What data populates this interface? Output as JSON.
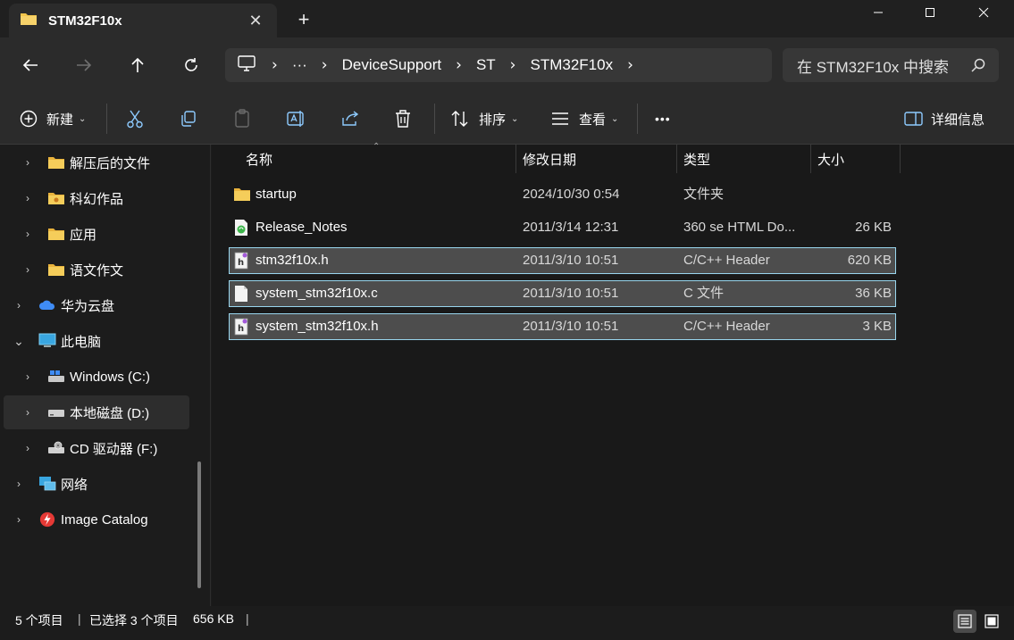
{
  "tab": {
    "title": "STM32F10x",
    "close_glyph": "✕",
    "new_tab_glyph": "+"
  },
  "window_buttons": {
    "minimize": "—",
    "maximize": "☐",
    "close": "✕"
  },
  "address": {
    "overflow": "···",
    "crumbs": [
      "DeviceSupport",
      "ST",
      "STM32F10x"
    ],
    "separator": "›"
  },
  "search": {
    "placeholder": "在 STM32F10x 中搜索"
  },
  "toolbar": {
    "new_label": "新建",
    "sort_label": "排序",
    "view_label": "查看",
    "more_label": "•••",
    "details_label": "详细信息"
  },
  "sidebar": {
    "items": [
      {
        "label": "解压后的文件",
        "icon": "folder-icon"
      },
      {
        "label": "科幻作品",
        "icon": "folder-icon"
      },
      {
        "label": "应用",
        "icon": "folder-icon"
      },
      {
        "label": "语文作文",
        "icon": "folder-icon"
      },
      {
        "label": "华为云盘",
        "icon": "cloud-icon"
      },
      {
        "label": "此电脑",
        "icon": "computer-icon"
      },
      {
        "label": "Windows (C:)",
        "icon": "drive-c-icon"
      },
      {
        "label": "本地磁盘 (D:)",
        "icon": "drive-icon"
      },
      {
        "label": "CD 驱动器 (F:)",
        "icon": "cd-drive-icon"
      },
      {
        "label": "网络",
        "icon": "network-icon"
      },
      {
        "label": "Image Catalog",
        "icon": "image-catalog-icon"
      }
    ]
  },
  "columns": {
    "name": "名称",
    "date": "修改日期",
    "type": "类型",
    "size": "大小"
  },
  "files": [
    {
      "name": "startup",
      "date": "2024/10/30 0:54",
      "type": "文件夹",
      "size": "",
      "icon": "folder-icon",
      "selected": false
    },
    {
      "name": "Release_Notes",
      "date": "2011/3/14 12:31",
      "type": "360 se HTML Do...",
      "size": "26 KB",
      "icon": "html-file-icon",
      "selected": false
    },
    {
      "name": "stm32f10x.h",
      "date": "2011/3/10 10:51",
      "type": "C/C++ Header",
      "size": "620 KB",
      "icon": "header-file-icon",
      "selected": true
    },
    {
      "name": "system_stm32f10x.c",
      "date": "2011/3/10 10:51",
      "type": "C 文件",
      "size": "36 KB",
      "icon": "c-file-icon",
      "selected": true
    },
    {
      "name": "system_stm32f10x.h",
      "date": "2011/3/10 10:51",
      "type": "C/C++ Header",
      "size": "3 KB",
      "icon": "header-file-icon",
      "selected": true
    }
  ],
  "status": {
    "count": "5 个项目",
    "selected": "已选择 3 个项目",
    "size": "656 KB",
    "sep": "|"
  },
  "colors": {
    "selection_border": "#99d6ee",
    "selection_bg": "#4d4d4d",
    "folder": "#f2c54b",
    "accent": "#4cc2ff"
  }
}
